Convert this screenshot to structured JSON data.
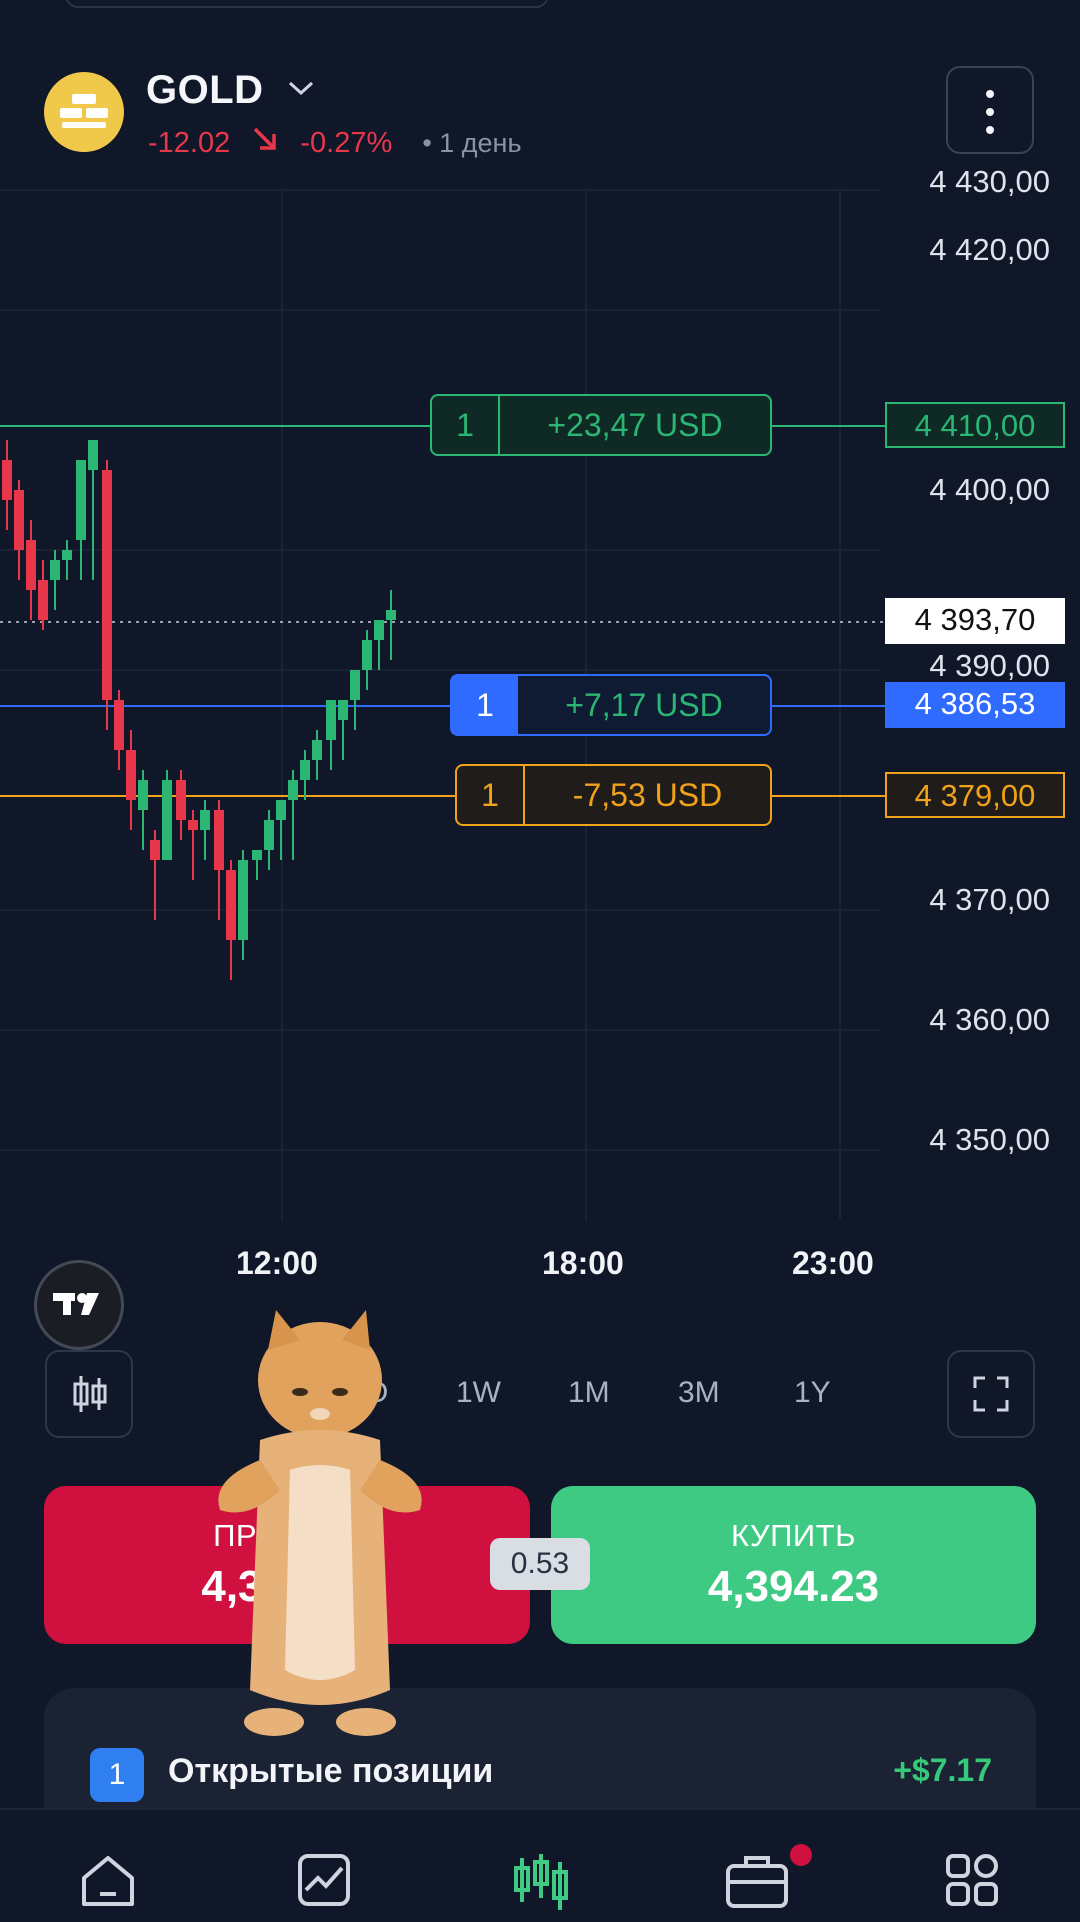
{
  "header": {
    "symbol": "GOLD",
    "change_abs": "-12.02",
    "change_pct": "-0.27%",
    "timeframe": "• 1 день",
    "logo_icon": "gold-bars-icon",
    "menu_icon": "more-vertical-icon"
  },
  "chart": {
    "price_axis": [
      "4 430,00",
      "4 420,00",
      "4 400,00",
      "4 390,00",
      "4 370,00",
      "4 360,00",
      "4 350,00"
    ],
    "time_axis": [
      "12:00",
      "18:00",
      "23:00"
    ],
    "current_price": "4 393,70",
    "take_profit": {
      "qty": "1",
      "pnl": "+23,47 USD",
      "price": "4 410,00",
      "color": "#2bb673"
    },
    "position": {
      "qty": "1",
      "pnl": "+7,17 USD",
      "price": "4 386,53",
      "color": "#2f6bff"
    },
    "stop_loss": {
      "qty": "1",
      "pnl": "-7,53 USD",
      "price": "4 379,00",
      "color": "#f0a21a"
    },
    "logo": "tradingview-logo"
  },
  "timeframes": {
    "items": [
      "1D",
      "1W",
      "1M",
      "3M",
      "1Y"
    ],
    "chart_type_icon": "candles-icon",
    "fullscreen_icon": "fullscreen-icon"
  },
  "trade": {
    "sell_label": "ПРОДАТЬ",
    "sell_price": "4,393.70",
    "buy_label": "КУПИТЬ",
    "buy_price": "4,394.23",
    "spread": "0.53"
  },
  "positions": {
    "count": "1",
    "title": "Открытые позиции",
    "pnl": "+$7.17"
  },
  "nav": {
    "items": [
      "home-icon",
      "chart-icon",
      "trade-icon",
      "portfolio-icon",
      "more-apps-icon"
    ]
  },
  "colors": {
    "background": "#0f1729",
    "up": "#2bb673",
    "down": "#e8374b",
    "sell": "#d0113f",
    "buy": "#3fca84"
  }
}
